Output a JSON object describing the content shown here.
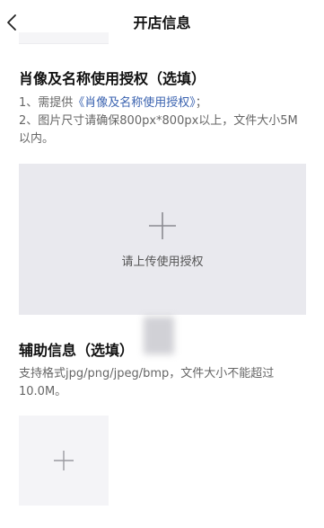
{
  "header": {
    "title": "开店信息",
    "back_icon": "chevron-left-icon"
  },
  "portrait_section": {
    "title": "肖像及名称使用授权（选填）",
    "line1_prefix": "1、需提供",
    "line1_link": "《肖像及名称使用授权》",
    "line1_suffix": "；",
    "line2": "2、图片尺寸请确保800px*800px以上，文件大小5M以内。",
    "upload_label": "请上传使用授权",
    "upload_icon": "plus-icon"
  },
  "aux_section": {
    "title": "辅助信息（选填）",
    "desc": "支持格式jpg/png/jpeg/bmp，文件大小不能超过10.0M。",
    "upload_icon": "plus-icon"
  },
  "colors": {
    "link": "#3b63b0",
    "upload_bg": "#e9e9ee",
    "upload_small_bg": "#f4f4f7",
    "text_secondary": "#666666"
  }
}
